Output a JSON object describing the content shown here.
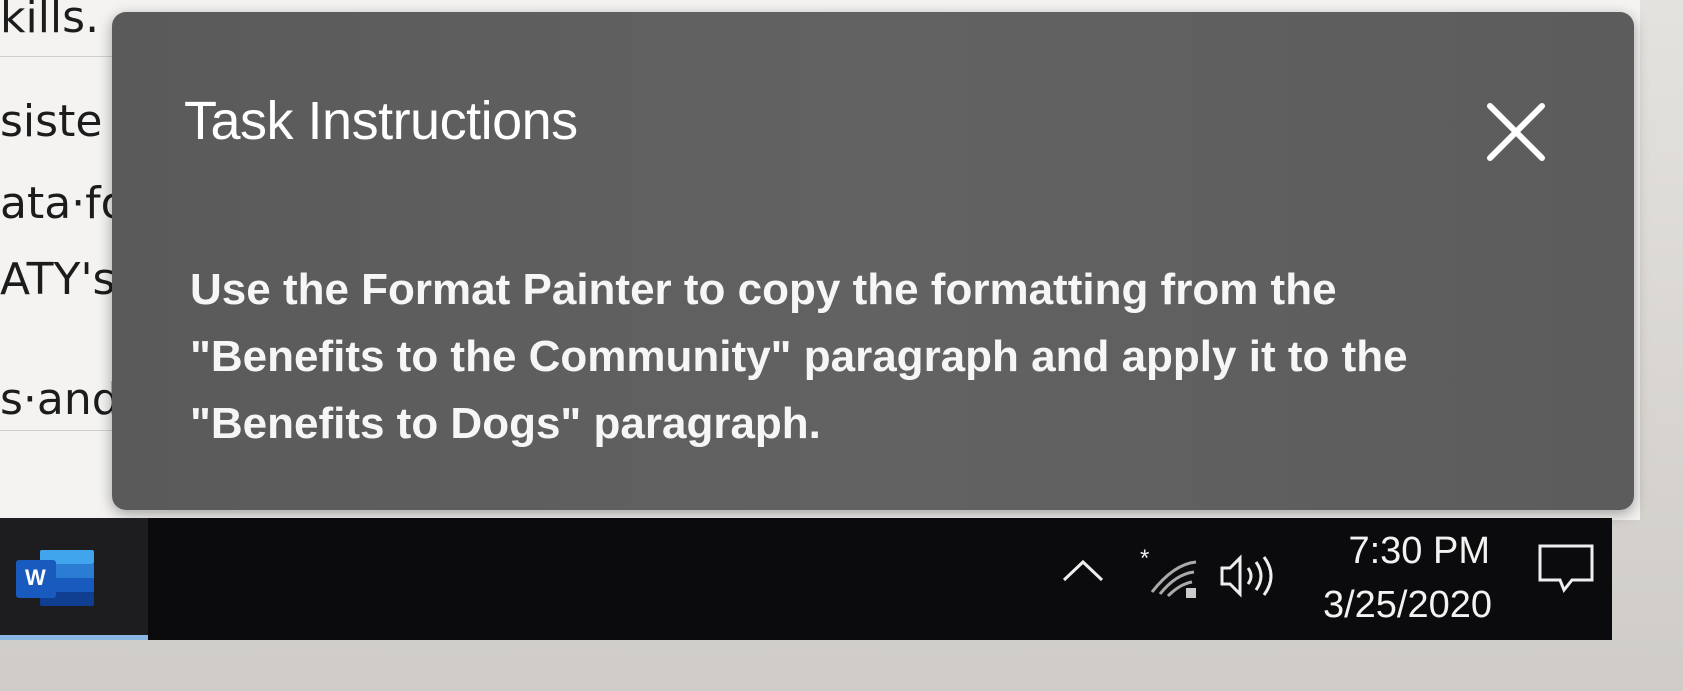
{
  "document": {
    "lines": [
      "kills.",
      "siste",
      "ata·fo",
      "ATY's·",
      "s·and"
    ]
  },
  "dialog": {
    "title": "Task Instructions",
    "close_icon": "close-icon",
    "instruction": "Use the Format Painter to copy the formatting from the \"Benefits to the Community\" paragraph and apply it to the \"Benefits to Dogs\" paragraph."
  },
  "taskbar": {
    "apps": [
      {
        "name": "Word",
        "icon": "word-icon",
        "label": "W"
      }
    ],
    "tray": {
      "icons": [
        "chevron-up-icon",
        "wifi-icon",
        "speaker-icon",
        "notification-icon"
      ],
      "time": "7:30 PM",
      "date": "3/25/2020"
    }
  },
  "colors": {
    "dialog_bg": "#5e5e5e",
    "taskbar_bg": "#0b0b0d",
    "word_blue": "#2b7cd3"
  }
}
